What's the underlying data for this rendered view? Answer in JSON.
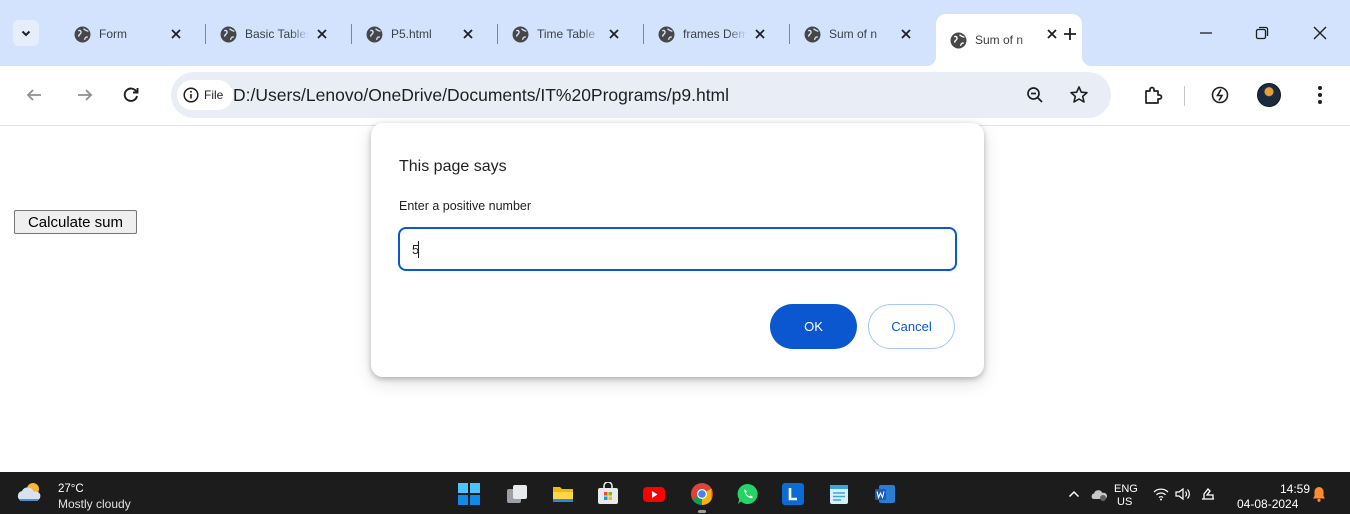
{
  "tabs": [
    {
      "title": "Form",
      "active": false
    },
    {
      "title": "Basic Tables",
      "active": false
    },
    {
      "title": "P5.html",
      "active": false
    },
    {
      "title": "Time Table",
      "active": false
    },
    {
      "title": "frames Demo",
      "active": false
    },
    {
      "title": "Sum of n",
      "active": false
    },
    {
      "title": "Sum of n",
      "active": true
    }
  ],
  "toolbar": {
    "chip_label": "File",
    "url": "D:/Users/Lenovo/OneDrive/Documents/IT%20Programs/p9.html"
  },
  "page": {
    "calc_button": "Calculate sum"
  },
  "dialog": {
    "title": "This page says",
    "message": "Enter a positive number",
    "input_value": "5",
    "ok_label": "OK",
    "cancel_label": "Cancel"
  },
  "taskbar": {
    "temperature": "27°C",
    "condition": "Mostly cloudy",
    "lang_line1": "ENG",
    "lang_line2": "US",
    "time": "14:59",
    "date": "04-08-2024",
    "apps": [
      "windows-start",
      "task-view",
      "file-explorer",
      "microsoft-store",
      "youtube",
      "chrome",
      "whatsapp",
      "l-app",
      "notepad",
      "word"
    ]
  },
  "colors": {
    "tabstrip_bg": "#d3e3fd",
    "accent": "#0b57d0",
    "taskbar_bg": "#1c1c1c"
  }
}
